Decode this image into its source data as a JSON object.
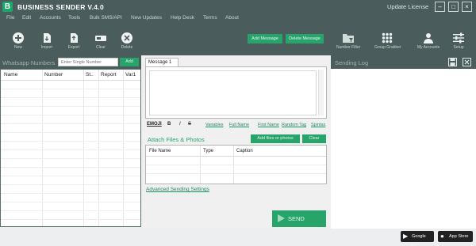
{
  "window": {
    "title": "BUSINESS SENDER V.4.0",
    "logo_letter": "B",
    "update_license": "Update License",
    "min": "–",
    "max": "□",
    "close": "×"
  },
  "menu": [
    "File",
    "Edit",
    "Accounts",
    "Tools",
    "Bulk SMS/API",
    "New Updates",
    "Help Desk",
    "Terms",
    "About"
  ],
  "toolbar": {
    "new": "New",
    "import": "Import",
    "export": "Export",
    "clear": "Clear",
    "delete": "Delete",
    "add_message": "Add Message",
    "delete_message": "Delete Message",
    "number_filter": "Number Filter",
    "group_grabber": "Group Grabber",
    "my_accounts": "My Accounts",
    "setup": "Setup"
  },
  "numbers_panel": {
    "title": "Whatsapp Numbers",
    "input_placeholder": "Enter Single Number",
    "add_label": "Add",
    "columns": [
      "Name",
      "Number",
      "St..",
      "Report",
      "Var1"
    ]
  },
  "message": {
    "tab_label": "Message 1",
    "emoji": "EMOJI",
    "bold": "B",
    "italic": "I",
    "strike": "S",
    "links": [
      "Variables",
      "Full Name",
      "First Name",
      "Random Tag",
      "Spintax"
    ]
  },
  "attach": {
    "title": "Attach Files & Photos",
    "add_files": "Add files or photos",
    "clear": "Clear",
    "columns": [
      "File Name",
      "Type",
      "Caption"
    ]
  },
  "advanced_settings": "Advanced Sending Settings",
  "send_label": "SEND",
  "sending_log": {
    "title": "Sending Log"
  },
  "stores": {
    "google_play": "Google Play",
    "app_store": "App Store"
  },
  "colors": {
    "header": "#4a5d5c",
    "accent": "#27a46a"
  }
}
